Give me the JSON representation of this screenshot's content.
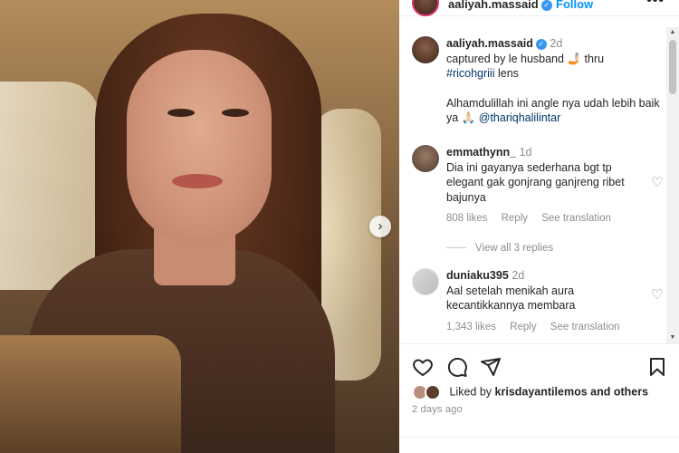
{
  "post": {
    "username": "aaliyah.massaid",
    "follow_label": "Follow",
    "more_label": "•••"
  },
  "caption": {
    "username": "aaliyah.massaid",
    "age": "2d",
    "text_1": "captured by le husband",
    "emoji_1": "🤳🏻",
    "text_2": "thru",
    "hashtag": "#ricohgriii",
    "text_3": "lens",
    "text_4": "Alhamdulillah ini angle nya udah lebih baik ya",
    "emoji_2": "🙏🏻",
    "mention": "@thariqhalilintar"
  },
  "comments": [
    {
      "username": "emmathynn_",
      "age": "1d",
      "text": "Dia ini gayanya sederhana bgt tp elegant gak gonjrang ganjreng ribet bajunya",
      "likes": "808 likes",
      "reply_label": "Reply",
      "translate_label": "See translation",
      "view_replies": "View all 3 replies"
    },
    {
      "username": "duniaku395",
      "age": "2d",
      "text": "Aal setelah menikah aura kecantikkannya membara",
      "likes": "1,343 likes",
      "reply_label": "Reply",
      "translate_label": "See translation"
    }
  ],
  "footer": {
    "liked_by_prefix": "Liked by",
    "liked_by_user": "krisdayantilemos",
    "liked_by_suffix": "and others",
    "time": "2 days ago"
  },
  "icons": {
    "like": "heart-icon",
    "comment": "comment-icon",
    "share": "send-icon",
    "save": "bookmark-icon",
    "next": "chevron-right-icon"
  },
  "colors": {
    "link_blue": "#0095f6",
    "verified_blue": "#3897f0",
    "text": "#262626",
    "muted": "#8e8e8e"
  }
}
